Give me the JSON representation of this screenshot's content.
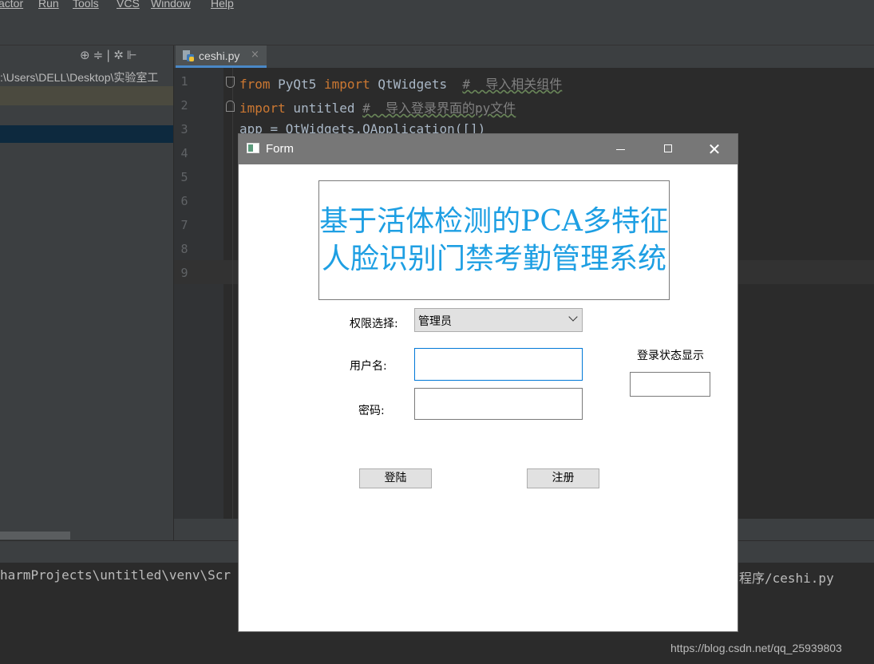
{
  "ide": {
    "menu": [
      "actor",
      "Run",
      "Tools",
      "VCS",
      "Window",
      "Help"
    ],
    "tab": {
      "file": "ceshi.py",
      "close": "×"
    },
    "project_path": ":\\Users\\DELL\\Desktop\\实验室工",
    "line_numbers": [
      "1",
      "2",
      "3",
      "4",
      "5",
      "6",
      "7",
      "8",
      "9"
    ],
    "code": {
      "line1": {
        "kw1": "from",
        "t1": " PyQt5 ",
        "kw2": "import",
        "t2": " QtWidgets  ",
        "comment": "#  导入相关组件"
      },
      "line2": {
        "kw1": "import",
        "t1": " untitled ",
        "comment": "#  导入登录界面的py文件"
      },
      "line3": "app = QtWidgets.QApplication([])"
    },
    "run_output_left": "harmProjects\\untitled\\venv\\Scr",
    "run_output_right": "程序/ceshi.py",
    "watermark": "https://blog.csdn.net/qq_25939803"
  },
  "form": {
    "window_title": "Form",
    "title_text": "基于活体检测的PCA多特征人脸识别门禁考勤管理系统",
    "permission_label": "权限选择:",
    "permission_value": "管理员",
    "username_label": "用户名:",
    "username_value": "",
    "password_label": "密码:",
    "password_value": "",
    "status_label": "登录状态显示",
    "status_value": "",
    "login_button": "登陆",
    "register_button": "注册"
  },
  "colors": {
    "title_text": "#1e9fe3",
    "focus_border": "#0078d7",
    "ide_background": "#2b2b2b"
  }
}
